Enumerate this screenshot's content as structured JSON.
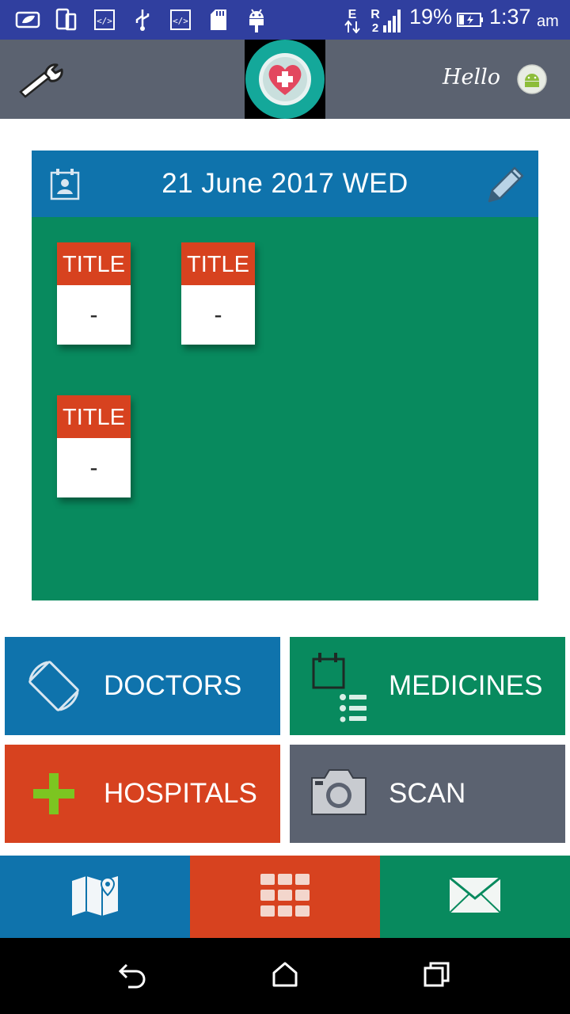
{
  "status_bar": {
    "battery_percent": "19%",
    "time": "1:37",
    "ampm": "am",
    "network_letter_top": "E",
    "network_letter_r": "R"
  },
  "app_bar": {
    "greeting": "Hello",
    "icons": [
      "wrench-icon",
      "heart-plus-logo",
      "android-avatar"
    ]
  },
  "calendar": {
    "date_label": "21 June 2017 WED",
    "notes": [
      {
        "title": "TITLE",
        "value": "-"
      },
      {
        "title": "TITLE",
        "value": "-"
      },
      {
        "title": "TITLE",
        "value": "-"
      }
    ]
  },
  "tiles": {
    "doctors": "DOCTORS",
    "medicines": "MEDICINES",
    "hospitals": "HOSPITALS",
    "scan": "SCAN"
  },
  "bottom_nav": [
    "map-icon",
    "grid-icon",
    "mail-icon"
  ],
  "colors": {
    "status_bar": "#303f9f",
    "app_bar": "#5b6270",
    "blue": "#0f73ac",
    "green": "#088a5e",
    "orange": "#d7421f",
    "gray": "#5b6270"
  }
}
